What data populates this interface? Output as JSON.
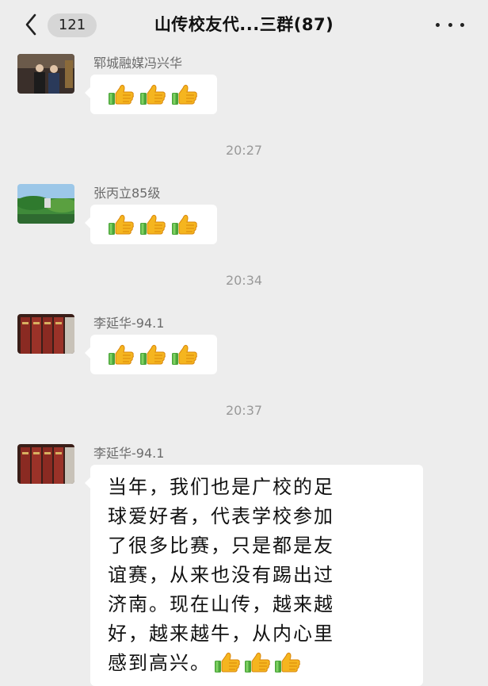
{
  "header": {
    "unread_count": "121",
    "title": "山传校友代...三群(87)"
  },
  "icons": {
    "back": "chevron-left-icon",
    "more": "more-dots-icon",
    "reaction": "thumbs-up-emoji"
  },
  "messages": [
    {
      "sender": "郓城融媒冯兴华",
      "content": "👍👍👍"
    },
    {
      "sender": "张丙立85级",
      "content": "👍👍👍"
    },
    {
      "sender": "李延华-94.1",
      "content": "👍👍👍"
    },
    {
      "sender": "李延华-94.1",
      "content": "当年，我们也是广校的足球爱好者，代表学校参加了很多比赛，只是都是友谊赛，从来也没有踢出过济南。现在山传，越来越好，越来越牛，从内心里感到高兴。👍👍👍"
    }
  ],
  "timestamps": [
    "20:27",
    "20:34",
    "20:37"
  ],
  "long_message_lines": [
    "当年，我们也是广校的足",
    "球爱好者，代表学校参加",
    "了很多比赛，只是都是友",
    "谊赛，从来也没有踢出过",
    "济南。现在山传，越来越",
    "好，越来越牛，从内心里",
    "感到高兴。"
  ],
  "colors": {
    "background": "#ededed",
    "bubble": "#ffffff",
    "timestamp": "#999999",
    "sender": "#6b6b6b"
  }
}
